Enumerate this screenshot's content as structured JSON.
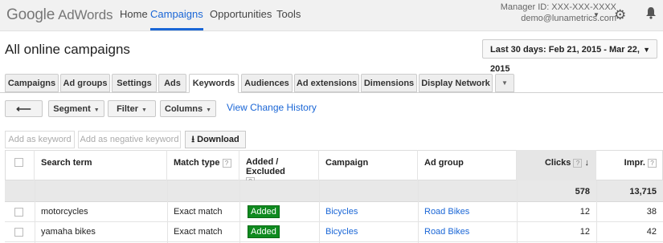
{
  "header": {
    "logo_google": "Google",
    "logo_product": "AdWords",
    "nav": [
      "Home",
      "Campaigns",
      "Opportunities",
      "Tools"
    ],
    "active_nav": "Campaigns",
    "manager_id": "Manager ID: XXX-XXX-XXXX",
    "email": "demo@lunametrics.com"
  },
  "page": {
    "title": "All online campaigns",
    "date_range": "Last 30 days: Feb 21, 2015 - Mar 22, 2015"
  },
  "tabs": [
    "Campaigns",
    "Ad groups",
    "Settings",
    "Ads",
    "Keywords",
    "Audiences",
    "Ad extensions",
    "Dimensions",
    "Display Network"
  ],
  "active_tab": "Keywords",
  "toolbar": {
    "segment": "Segment",
    "filter": "Filter",
    "columns": "Columns",
    "history_link": "View Change History",
    "add_keyword": "Add as keyword",
    "add_negative": "Add as negative keyword",
    "download": "Download"
  },
  "table": {
    "headers": {
      "search_term": "Search term",
      "match_type": "Match type",
      "added_excluded": "Added / Excluded",
      "campaign": "Campaign",
      "ad_group": "Ad group",
      "clicks": "Clicks",
      "impr": "Impr."
    },
    "totals": {
      "clicks": "578",
      "impr": "13,715"
    },
    "rows": [
      {
        "search_term": "motorcycles",
        "match_type": "Exact match",
        "status": "Added",
        "campaign": "Bicycles",
        "ad_group": "Road Bikes",
        "clicks": "12",
        "impr": "38"
      },
      {
        "search_term": "yamaha bikes",
        "match_type": "Exact match",
        "status": "Added",
        "campaign": "Bicycles",
        "ad_group": "Road Bikes",
        "clicks": "12",
        "impr": "42"
      }
    ]
  },
  "colors": {
    "accent": "#1a66d6",
    "added_badge": "#0f8a1f"
  }
}
